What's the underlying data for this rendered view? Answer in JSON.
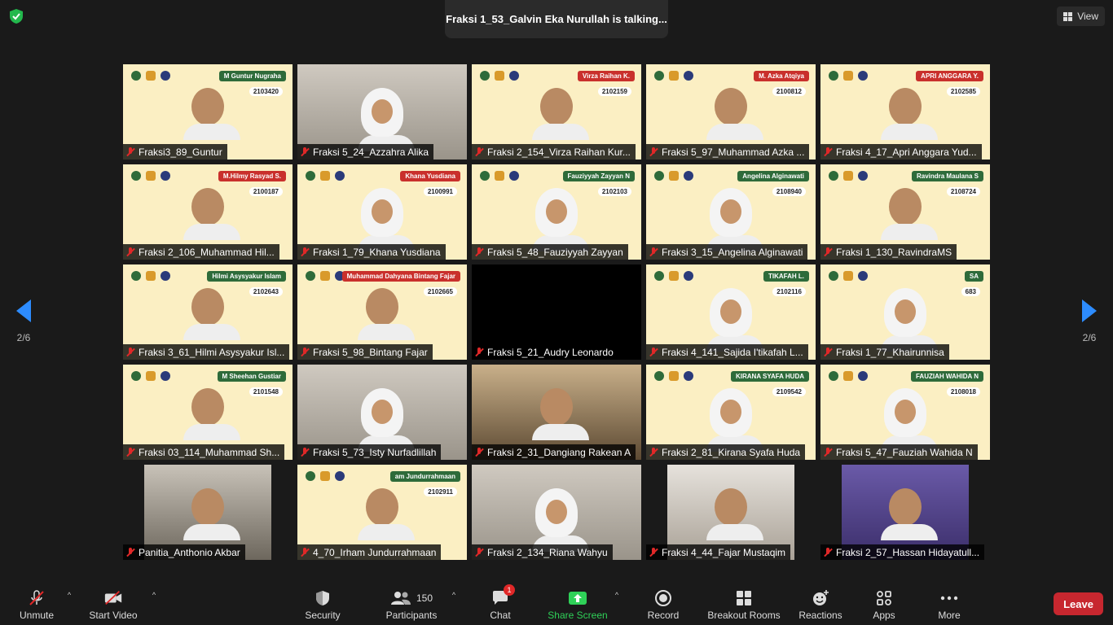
{
  "header": {
    "talking_text": "Fraksi 1_53_Galvin Eka Nurullah is talking...",
    "view_label": "View"
  },
  "pagination": {
    "left_page": "2/6",
    "right_page": "2/6"
  },
  "tiles": [
    {
      "name": "Fraksi3_89_Guntur",
      "plate": "M Guntur Nugraha",
      "id": "2103420",
      "plate_color": "green"
    },
    {
      "name": "Fraksi 5_24_Azzahra Alika"
    },
    {
      "name": "Fraksi 2_154_Virza Raihan Kur...",
      "plate": "Virza Raihan K.",
      "id": "2102159",
      "plate_color": "red"
    },
    {
      "name": "Fraksi 5_97_Muhammad Azka ...",
      "plate": "M. Azka Atqiya",
      "id": "2100812",
      "plate_color": "red"
    },
    {
      "name": "Fraksi 4_17_Apri Anggara Yud...",
      "plate": "APRI ANGGARA Y.",
      "id": "2102585",
      "plate_color": "red"
    },
    {
      "name": "Fraksi 2_106_Muhammad Hil...",
      "plate": "M.Hilmy Rasyad S.",
      "id": "2100187",
      "plate_color": "red"
    },
    {
      "name": "Fraksi 1_79_Khana Yusdiana",
      "plate": "Khana Yusdiana",
      "id": "2100991",
      "plate_color": "red"
    },
    {
      "name": "Fraksi 5_48_Fauziyyah Zayyan",
      "plate": "Fauziyyah Zayyan N",
      "id": "2102103",
      "plate_color": "green"
    },
    {
      "name": "Fraksi 3_15_Angelina Alginawati",
      "plate": "Angelina Alginawati",
      "id": "2108940",
      "plate_color": "green"
    },
    {
      "name": "Fraksi 1_130_RavindraMS",
      "plate": "Ravindra Maulana S",
      "id": "2108724",
      "plate_color": "green"
    },
    {
      "name": "Fraksi 3_61_Hilmi Asysyakur Isl...",
      "plate": "Hilmi Asysyakur Islam",
      "id": "2102643",
      "plate_color": "green"
    },
    {
      "name": "Fraksi 5_98_Bintang Fajar",
      "plate": "Muhammad Dahyana Bintang Fajar",
      "id": "2102665",
      "plate_color": "red"
    },
    {
      "name": "Fraksi 5_21_Audry Leonardo"
    },
    {
      "name": "Fraksi 4_141_Sajida I'tikafah L...",
      "plate": "TIKAFAH L.",
      "id": "2102116",
      "plate_color": "green"
    },
    {
      "name": "Fraksi 1_77_Khairunnisa",
      "plate": "SA",
      "id": "683",
      "plate_color": "green"
    },
    {
      "name": "Fraksi 03_114_Muhammad Sh...",
      "plate": "M Sheehan Gustiar",
      "id": "2101548",
      "plate_color": "green"
    },
    {
      "name": "Fraksi 5_73_Isty Nurfadlillah"
    },
    {
      "name": "Fraksi 2_31_Dangiang Rakean A"
    },
    {
      "name": "Fraksi 2_81_Kirana Syafa Huda",
      "plate": "KIRANA SYAFA HUDA",
      "id": "2109542",
      "plate_color": "green"
    },
    {
      "name": "Fraksi 5_47_Fauziah Wahida N",
      "plate": "FAUZIAH WAHIDA N",
      "id": "2108018",
      "plate_color": "green"
    },
    {
      "name": "Panitia_Anthonio Akbar"
    },
    {
      "name": "4_70_Irham Jundurrahmaan",
      "plate": "am Jundurrahmaan",
      "id": "2102911",
      "plate_color": "green"
    },
    {
      "name": "Fraksi 2_134_Riana Wahyu"
    },
    {
      "name": "Fraksi 4_44_Fajar Mustaqim"
    },
    {
      "name": "Fraksi 2_57_Hassan Hidayatull..."
    }
  ],
  "toolbar": {
    "unmute": "Unmute",
    "start_video": "Start Video",
    "security": "Security",
    "participants": "Participants",
    "participants_count": "150",
    "chat": "Chat",
    "chat_badge": "1",
    "share_screen": "Share Screen",
    "record": "Record",
    "breakout_rooms": "Breakout Rooms",
    "reactions": "Reactions",
    "apps": "Apps",
    "more": "More",
    "leave": "Leave",
    "caret": "^"
  },
  "colors": {
    "accent_blue": "#2d8cff",
    "share_green": "#2fd158",
    "leave_red": "#c7272f",
    "mute_red": "#e02828",
    "tile_background": "#fbefc3"
  }
}
